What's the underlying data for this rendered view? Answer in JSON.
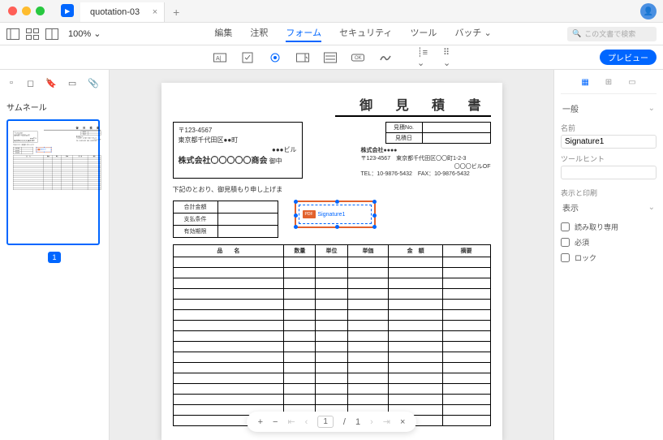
{
  "titlebar": {
    "tab_name": "quotation-03",
    "add": "+"
  },
  "toolbar": {
    "zoom": "100% ⌄",
    "menus": {
      "edit": "編集",
      "annotate": "注釈",
      "form": "フォーム",
      "security": "セキュリティ",
      "tool": "ツール",
      "batch": "バッチ ⌄"
    },
    "search_placeholder": "この文書で検索"
  },
  "subtoolbar": {
    "preview": "プレビュー"
  },
  "left": {
    "title": "サムネール",
    "page_num": "1"
  },
  "document": {
    "title": "御 見 積 書",
    "addr1": "〒123-4567",
    "addr2": "東京都千代田区●●町",
    "addr3": "●●●ビル",
    "company": "株式会社〇〇〇〇〇商会",
    "attn": "御中",
    "qno_label": "見積No.",
    "qdate_label": "見積日",
    "right_company": "株式会社●●●●",
    "right_addr": "〒123-4567　東京都千代田区〇〇町1-2-3",
    "right_bldg": "〇〇〇ビルOF",
    "right_tel": "TEL：10-9876-5432　FAX：10-9876-5432",
    "note": "下記のとおり、御見積もり申し上げま",
    "total_label": "合計金額",
    "pay_label": "支払条件",
    "valid_label": "有効期限",
    "sig_name": "Signature1",
    "cols": {
      "name": "品　　名",
      "qty": "数量",
      "unit": "単位",
      "price": "単価",
      "amount": "金　額",
      "remark": "摘要"
    }
  },
  "pagenav": {
    "cur": "1",
    "total": "1"
  },
  "props": {
    "tab_general": "一般",
    "name_label": "名前",
    "name_value": "Signature1",
    "hint_label": "ツールヒント",
    "display_section": "表示と印刷",
    "display_label": "表示",
    "readonly": "読み取り専用",
    "required": "必須",
    "locked": "ロック"
  }
}
